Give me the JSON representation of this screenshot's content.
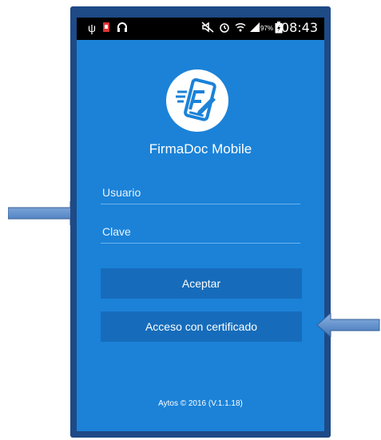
{
  "status_bar": {
    "usb_icon": "usb-icon",
    "app_notification_icon": "app-notification-icon",
    "headset_icon": "headset-icon",
    "mute_icon": "mute-icon",
    "alarm_icon": "alarm-icon",
    "wifi_icon": "wifi-icon",
    "signal_icon": "signal-icon",
    "battery_percent": "97%",
    "battery_icon": "battery-icon",
    "time": "08:43"
  },
  "app": {
    "title": "FirmaDoc Mobile",
    "logo_icon": "signature-phone-icon"
  },
  "form": {
    "username_placeholder": "Usuario",
    "password_placeholder": "Clave",
    "accept_label": "Aceptar",
    "certificate_label": "Acceso con certificado"
  },
  "footer": {
    "text": "Aytos © 2016 (V.1.1.18)"
  },
  "colors": {
    "screen_bg": "#1b82d8",
    "button_bg": "#166cbb",
    "frame": "#1e4a86",
    "arrow": "#4f86c6"
  }
}
